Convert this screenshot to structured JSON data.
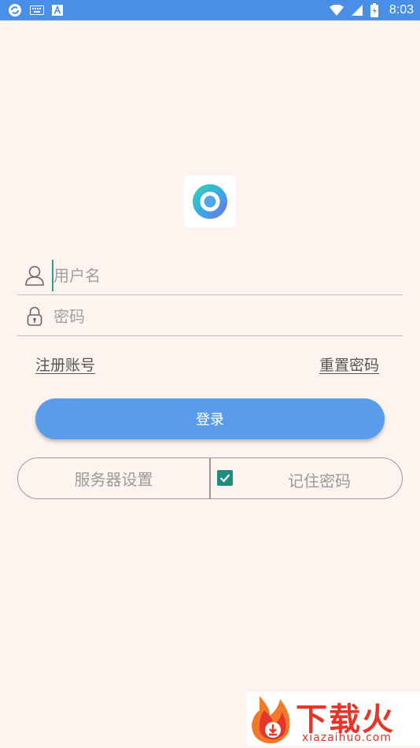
{
  "status_bar": {
    "time": "8:03",
    "left_icons": [
      "sync-icon",
      "keyboard-icon",
      "text-a-icon"
    ],
    "right_icons": [
      "wifi-icon",
      "signal-icon",
      "battery-icon"
    ],
    "bg_color": "#4a8fe7"
  },
  "login": {
    "username_placeholder": "用户名",
    "password_placeholder": "密码",
    "register_link": "注册账号",
    "reset_link": "重置密码",
    "login_button": "登录",
    "server_settings": "服务器设置",
    "remember_password": "记住密码",
    "remember_checked": true,
    "accent_color": "#5b9bec"
  },
  "watermark": {
    "brand": "下载火",
    "url": "xiazaihuo.com"
  }
}
